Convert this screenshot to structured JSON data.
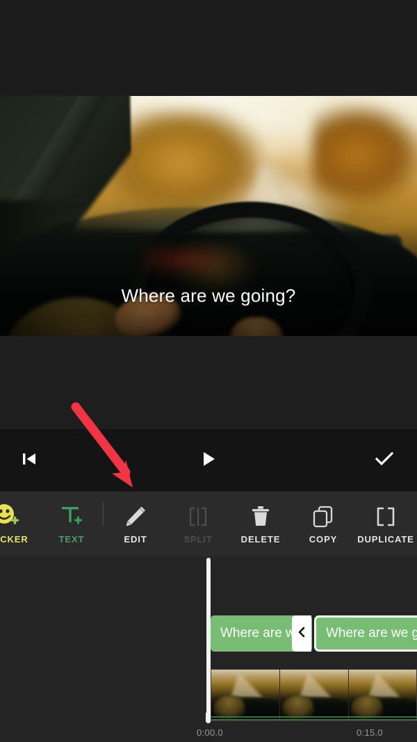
{
  "app": {
    "name": "video-editor",
    "background_color": "#000000",
    "panel_color": "#2b2b2b",
    "accent_green": "#78bd73",
    "accent_yellow": "#e8e46a",
    "annotation_color": "#f23545"
  },
  "preview": {
    "caption_text": "Where are we going?",
    "caption_color": "#ffffff",
    "scene_description": "blurred view through car windshield of autumn road"
  },
  "playback_controls": {
    "skip_to_start": {
      "label": "",
      "icon": "skip-to-start-icon"
    },
    "play": {
      "label": "",
      "icon": "play-icon"
    },
    "done": {
      "label": "",
      "icon": "checkmark-icon"
    }
  },
  "toolbar": {
    "items": [
      {
        "label": "STICKER",
        "icon": "sticker-smiley-plus-icon",
        "enabled": true,
        "color": "#e8e46a"
      },
      {
        "label": "TEXT",
        "icon": "text-t-plus-icon",
        "enabled": true,
        "color": "#4f9d63"
      },
      {
        "label": "EDIT",
        "icon": "pencil-icon",
        "enabled": true,
        "color": "#e6e6e6"
      },
      {
        "label": "SPLIT",
        "icon": "split-brackets-icon",
        "enabled": false,
        "color": "#4d4d4d"
      },
      {
        "label": "DELETE",
        "icon": "trash-icon",
        "enabled": true,
        "color": "#e6e6e6"
      },
      {
        "label": "COPY",
        "icon": "copy-stacked-icon",
        "enabled": true,
        "color": "#e6e6e6"
      },
      {
        "label": "DUPLICATE",
        "icon": "duplicate-brackets-icon",
        "enabled": true,
        "color": "#e6e6e6"
      }
    ]
  },
  "timeline": {
    "text_clips": [
      {
        "label": "Where are w",
        "selected": false
      },
      {
        "label": "Where are we g",
        "selected": true
      }
    ],
    "handle_icon": "chevron-left-icon",
    "video_thumbnails": 3,
    "playhead_position_label": "0:00.0"
  },
  "scrubber": {
    "start_time": "0:00.0",
    "end_time": "0:15.0"
  },
  "annotation": {
    "type": "arrow",
    "points_to": "EDIT",
    "color": "#f23545"
  }
}
